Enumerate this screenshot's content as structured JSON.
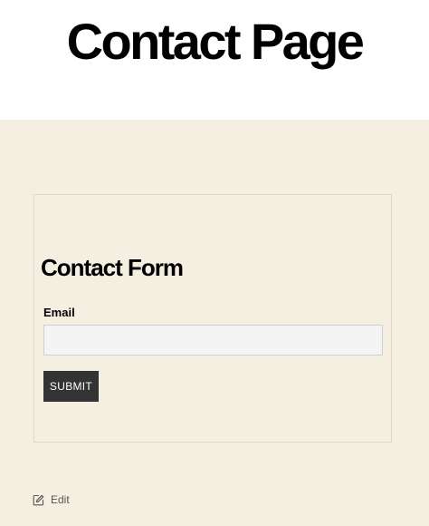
{
  "header": {
    "title": "Contact Page"
  },
  "form": {
    "heading": "Contact Form",
    "email_label": "Email",
    "email_value": "",
    "submit_label": "SUBMIT"
  },
  "footer": {
    "edit_label": "Edit",
    "edit_icon": "edit-icon"
  },
  "colors": {
    "content_background": "#f5efe2",
    "submit_background": "#333333",
    "input_background": "#f4f4f4"
  }
}
